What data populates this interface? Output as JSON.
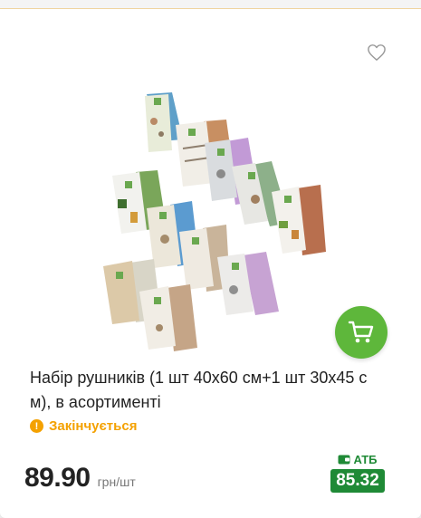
{
  "product": {
    "title": "Набір рушників (1 шт 40x60 см+1 шт 30x45 с м), в асортименті",
    "status": "Закінчується",
    "status_icon": "!",
    "price": "89.90",
    "unit": "грн/шт",
    "club_label": "АТБ",
    "club_price": "85.32"
  },
  "icons": {
    "favorite": "heart-outline-icon",
    "cart": "shopping-cart-icon",
    "club": "wallet-icon",
    "status": "warning-circle-icon"
  },
  "colors": {
    "accent_green": "#5eb73b",
    "club_green": "#1f8a36",
    "warning": "#f4a100"
  }
}
